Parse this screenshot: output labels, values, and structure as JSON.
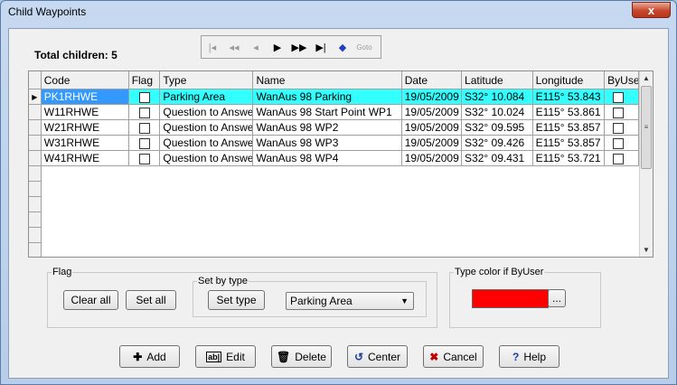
{
  "window": {
    "title": "Child Waypoints",
    "close_glyph": "x"
  },
  "total_children": "Total children: 5",
  "navigator": [
    {
      "icon": "first-record-icon",
      "glyph": "|◂",
      "enabled": false
    },
    {
      "icon": "prior-page-icon",
      "glyph": "◂◂",
      "enabled": false
    },
    {
      "icon": "prior-record-icon",
      "glyph": "◂",
      "enabled": false
    },
    {
      "icon": "next-record-icon",
      "glyph": "▶",
      "enabled": true
    },
    {
      "icon": "next-page-icon",
      "glyph": "▶▶",
      "enabled": true
    },
    {
      "icon": "last-record-icon",
      "glyph": "▶|",
      "enabled": true
    },
    {
      "icon": "bookmark-icon",
      "glyph": "◆",
      "enabled": true
    },
    {
      "icon": "goto-icon",
      "glyph": "Goto",
      "enabled": false
    }
  ],
  "columns": [
    "Code",
    "Flag",
    "Type",
    "Name",
    "Date",
    "Latitude",
    "Longitude",
    "ByUser"
  ],
  "rows": [
    {
      "code": "PK1RHWE",
      "type": "Parking Area",
      "name": "WanAus 98 Parking",
      "date": "19/05/2009",
      "lat": "S32° 10.084",
      "lon": "E115° 53.843",
      "selected": true
    },
    {
      "code": "W11RHWE",
      "type": "Question to Answer",
      "name": "WanAus 98 Start Point WP1",
      "date": "19/05/2009",
      "lat": "S32° 10.024",
      "lon": "E115° 53.861",
      "selected": false
    },
    {
      "code": "W21RHWE",
      "type": "Question to Answer",
      "name": "WanAus 98 WP2",
      "date": "19/05/2009",
      "lat": "S32° 09.595",
      "lon": "E115° 53.857",
      "selected": false
    },
    {
      "code": "W31RHWE",
      "type": "Question to Answer",
      "name": "WanAus 98 WP3",
      "date": "19/05/2009",
      "lat": "S32° 09.426",
      "lon": "E115° 53.857",
      "selected": false
    },
    {
      "code": "W41RHWE",
      "type": "Question to Answer",
      "name": "WanAus 98 WP4",
      "date": "19/05/2009",
      "lat": "S32° 09.431",
      "lon": "E115° 53.721",
      "selected": false
    }
  ],
  "flag_group": {
    "legend": "Flag",
    "clear_all": "Clear all",
    "set_all": "Set all"
  },
  "set_by_type": {
    "legend": "Set by type",
    "set_type": "Set type",
    "selected_type": "Parking Area"
  },
  "type_color": {
    "legend": "Type color if ByUser",
    "color": "#ff0000",
    "browse": "..."
  },
  "buttons": {
    "add": "Add",
    "edit": "Edit",
    "delete": "Delete",
    "center": "Center",
    "cancel": "Cancel",
    "help": "Help"
  },
  "colors": {
    "selected_row": "#33ffff",
    "selected_cell": "#3399ff",
    "title_gradient": "#c6d9f0"
  }
}
